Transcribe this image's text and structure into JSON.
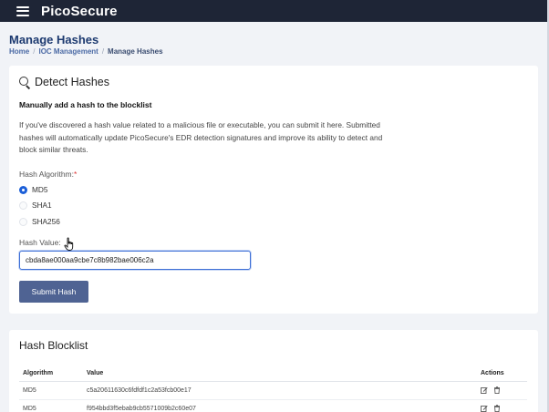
{
  "app": {
    "brand": "PicoSecure"
  },
  "header": {
    "title": "Manage Hashes"
  },
  "breadcrumb": {
    "items": [
      "Home",
      "IOC Management"
    ],
    "current": "Manage Hashes"
  },
  "detect": {
    "title": "Detect Hashes",
    "subhead": "Manually add a hash to the blocklist",
    "description": "If you've discovered a hash value related to a malicious file or executable, you can submit it here. Submitted hashes will automatically update PicoSecure's EDR detection signatures and improve its ability to detect and block similar threats.",
    "algorithm_label": "Hash Algorithm:",
    "required_mark": "*",
    "algorithms": [
      {
        "label": "MD5",
        "checked": true
      },
      {
        "label": "SHA1",
        "checked": false
      },
      {
        "label": "SHA256",
        "checked": false
      }
    ],
    "hash_label": "Hash Value:",
    "hash_value": "cbda8ae000aa9cbe7c8b982bae006c2a",
    "submit_label": "Submit Hash"
  },
  "blocklist": {
    "title": "Hash Blocklist",
    "columns": [
      "Algorithm",
      "Value",
      "Actions"
    ],
    "rows": [
      {
        "algorithm": "MD5",
        "value": "c5a20611630c6fdfdf1c2a53fcb00e17"
      },
      {
        "algorithm": "MD5",
        "value": "f954bbd3f5ebab9cb5571009b2c60e07"
      }
    ]
  },
  "icons": {
    "menu": "hamburger-icon",
    "search": "search-icon",
    "edit": "edit-icon",
    "delete": "trash-icon",
    "cursor": "hand-cursor-icon"
  },
  "colors": {
    "topbar": "#1e2536",
    "title": "#1d3a70",
    "accent": "#1c5fd8",
    "button": "#4f6393",
    "background": "#f1f3f7"
  }
}
